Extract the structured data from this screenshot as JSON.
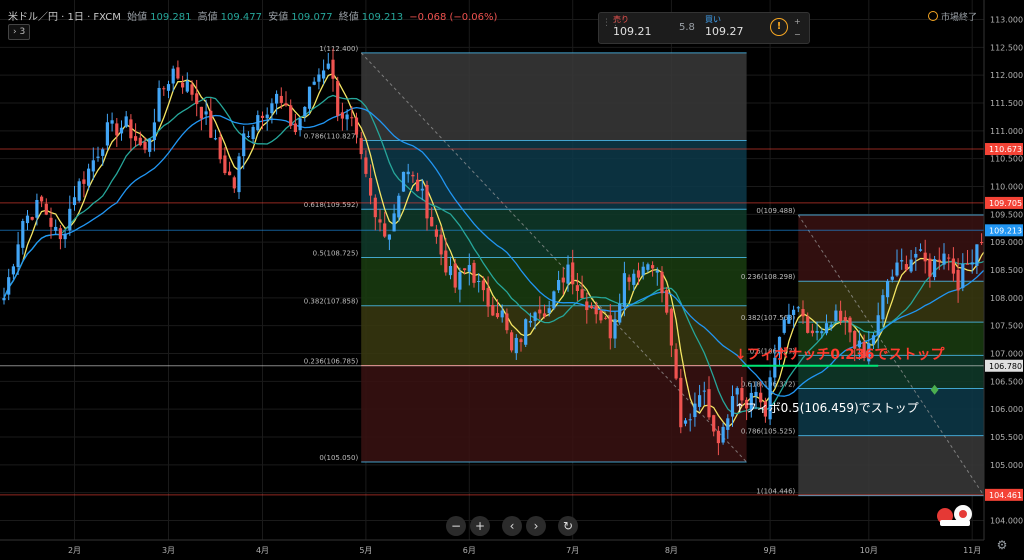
{
  "header": {
    "symbol": "米ドル／円 · 1日 · FXCM",
    "open_label": "始値",
    "open": "109.281",
    "high_label": "高値",
    "high": "109.477",
    "low_label": "安値",
    "low": "109.077",
    "close_label": "終値",
    "close": "109.213",
    "change": "−0.068 (−0.06%)",
    "indicator_count": "3"
  },
  "trade": {
    "sell_label": "売り",
    "sell_price": "109.21",
    "spread": "5.8",
    "buy_label": "買い",
    "buy_price": "109.27",
    "info_icon": "!",
    "step_up": "+",
    "step_down": "−"
  },
  "market_status": "市場終了",
  "toolbar": {
    "zoom_out": "−",
    "zoom_in": "+",
    "prev": "‹",
    "next": "›",
    "reset": "↻"
  },
  "colors": {
    "background": "#000000",
    "bull": "#42a5f5",
    "bear": "#ef5350",
    "ma_fast": "#f5e663",
    "ma_mid": "#26a69a",
    "ma_slow": "#2196f3",
    "fib_line": "#4fc3f7",
    "annotation_red": "#ff3b30",
    "annotation_white": "#ffffff"
  },
  "chart_data": {
    "type": "candlestick",
    "x_axis": {
      "labels": [
        "2月",
        "3月",
        "4月",
        "5月",
        "6月",
        "7月",
        "8月",
        "9月",
        "10月",
        "11月"
      ],
      "label_index": [
        15,
        35,
        55,
        77,
        99,
        121,
        142,
        163,
        184,
        206
      ]
    },
    "y_axis": {
      "range": [
        103.65,
        113.35
      ],
      "ticks": [
        "104.000",
        "104.500",
        "105.000",
        "105.500",
        "106.000",
        "106.500",
        "107.000",
        "107.500",
        "108.000",
        "108.500",
        "109.000",
        "109.500",
        "110.000",
        "110.500",
        "111.000",
        "111.500",
        "112.000",
        "112.500",
        "113.000"
      ]
    },
    "grid": true,
    "candle_count": 210,
    "close_keyframes": [
      [
        0,
        108.0
      ],
      [
        4,
        109.4
      ],
      [
        8,
        109.7
      ],
      [
        12,
        109.0
      ],
      [
        15,
        109.9
      ],
      [
        18,
        110.3
      ],
      [
        22,
        111.0
      ],
      [
        26,
        111.1
      ],
      [
        30,
        110.6
      ],
      [
        33,
        111.6
      ],
      [
        36,
        112.1
      ],
      [
        40,
        111.7
      ],
      [
        43,
        111.2
      ],
      [
        46,
        110.5
      ],
      [
        49,
        110.0
      ],
      [
        51,
        110.9
      ],
      [
        54,
        111.3
      ],
      [
        58,
        111.6
      ],
      [
        62,
        111.0
      ],
      [
        66,
        111.9
      ],
      [
        69,
        112.3
      ],
      [
        71,
        111.4
      ],
      [
        74,
        111.1
      ],
      [
        77,
        110.1
      ],
      [
        79,
        109.4
      ],
      [
        82,
        109.2
      ],
      [
        85,
        110.3
      ],
      [
        88,
        110.0
      ],
      [
        90,
        109.6
      ],
      [
        93,
        108.8
      ],
      [
        96,
        108.2
      ],
      [
        99,
        108.6
      ],
      [
        102,
        108.0
      ],
      [
        106,
        107.7
      ],
      [
        108,
        107.0
      ],
      [
        110,
        107.3
      ],
      [
        113,
        107.9
      ],
      [
        116,
        107.8
      ],
      [
        120,
        108.6
      ],
      [
        123,
        108.0
      ],
      [
        126,
        107.8
      ],
      [
        129,
        107.4
      ],
      [
        132,
        108.4
      ],
      [
        135,
        108.5
      ],
      [
        138,
        108.7
      ],
      [
        140,
        108.1
      ],
      [
        142,
        107.2
      ],
      [
        144,
        105.6
      ],
      [
        146,
        105.9
      ],
      [
        148,
        106.4
      ],
      [
        150,
        106.0
      ],
      [
        152,
        105.5
      ],
      [
        154,
        106.0
      ],
      [
        156,
        106.4
      ],
      [
        158,
        106.0
      ],
      [
        160,
        106.3
      ],
      [
        162,
        106.0
      ],
      [
        165,
        107.3
      ],
      [
        168,
        107.8
      ],
      [
        171,
        107.4
      ],
      [
        174,
        107.3
      ],
      [
        177,
        107.6
      ],
      [
        180,
        107.4
      ],
      [
        183,
        106.9
      ],
      [
        186,
        107.6
      ],
      [
        188,
        108.3
      ],
      [
        191,
        108.6
      ],
      [
        194,
        108.8
      ],
      [
        197,
        108.5
      ],
      [
        200,
        108.9
      ],
      [
        203,
        108.3
      ],
      [
        205,
        108.6
      ],
      [
        207,
        109.0
      ],
      [
        209,
        109.213
      ]
    ],
    "last": {
      "open": 109.281,
      "high": 109.477,
      "low": 109.077,
      "close": 109.213
    },
    "price_labels": [
      {
        "value": 110.673,
        "text": "110.673",
        "color": "#f44336"
      },
      {
        "value": 109.705,
        "text": "109.705",
        "color": "#f44336"
      },
      {
        "value": 109.213,
        "text": "109.213",
        "color": "#2196f3"
      },
      {
        "value": 106.78,
        "text": "106.780",
        "color": "#e0e0e0"
      },
      {
        "value": 104.461,
        "text": "104.461",
        "color": "#f44336"
      }
    ],
    "fib_retracement_1": {
      "from_index": 76,
      "to_index": 158,
      "levels": [
        {
          "ratio": 1,
          "price": 112.4,
          "label": "1(112.400)",
          "fill": "#3a3a3a"
        },
        {
          "ratio": 0.786,
          "price": 110.827,
          "label": "0.786(110.827)",
          "fill": "#0d3a4a"
        },
        {
          "ratio": 0.618,
          "price": 109.592,
          "label": "0.618(109.592)",
          "fill": "#0f3b2a"
        },
        {
          "ratio": 0.5,
          "price": 108.725,
          "label": "0.5(108.725)",
          "fill": "#1a3d10"
        },
        {
          "ratio": 0.382,
          "price": 107.858,
          "label": "0.382(107.858)",
          "fill": "#3a3a10"
        },
        {
          "ratio": 0.236,
          "price": 106.785,
          "label": "0.236(106.785)",
          "fill": "#3a1212"
        },
        {
          "ratio": 0,
          "price": 105.05,
          "label": "0(105.050)",
          "fill": "none"
        }
      ]
    },
    "fib_retracement_2": {
      "from_index": 169,
      "to_index": 226,
      "levels": [
        {
          "ratio": 0,
          "price": 109.488,
          "label": "0(109.488)",
          "fill": "#3a1212"
        },
        {
          "ratio": 0.236,
          "price": 108.298,
          "label": "0.236(108.298)",
          "fill": "#3a3a10"
        },
        {
          "ratio": 0.382,
          "price": 107.563,
          "label": "0.382(107.563)",
          "fill": "#1a3d10"
        },
        {
          "ratio": 0.5,
          "price": 106.967,
          "label": "0.5(106.967)",
          "fill": "#0f3b2a"
        },
        {
          "ratio": 0.618,
          "price": 106.372,
          "label": "0.618(106.372)",
          "fill": "#0d3a4a"
        },
        {
          "ratio": 0.786,
          "price": 105.525,
          "label": "0.786(105.525)",
          "fill": "#3a3a3a"
        },
        {
          "ratio": 1,
          "price": 104.446,
          "label": "1(104.446)",
          "fill": "none"
        }
      ]
    },
    "annotations": [
      {
        "text": "↓フィボナッチ0.236でストップ",
        "color": "#ff3b30",
        "index": 164,
        "price": 106.9
      },
      {
        "text": "↑フィボ0.5(106.459)でストップ",
        "color": "#ffffff",
        "index": 164,
        "price": 105.95
      }
    ],
    "horizontal_ray": {
      "price": 106.78,
      "from_index": 157,
      "to_index": 186,
      "color": "#00e676"
    },
    "marker": {
      "index": 198,
      "price": 106.35,
      "color": "#4caf50"
    }
  }
}
